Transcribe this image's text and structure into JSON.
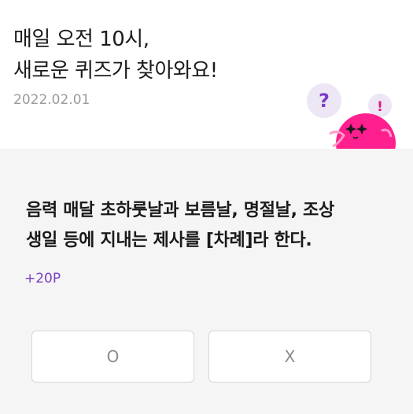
{
  "header": {
    "title_line1": "매일 오전 10시,",
    "title_line2": "새로운 퀴즈가 찾아와요!",
    "date": "2022.02.01"
  },
  "mascot": {
    "bubble_text": "?",
    "exclaim_text": "!",
    "body_color": "#ff1f8e",
    "bubble_color": "#ece6f5",
    "accent_color": "#7b3fc4"
  },
  "quiz": {
    "question_line1": "음력 매달 초하룻날과 보름날, 명절날, 조상",
    "question_line2": "생일 등에 지내는 제사를 [차례]라 한다.",
    "points": "+20P",
    "answer_o": "O",
    "answer_x": "X"
  },
  "colors": {
    "background": "#f5f5f5",
    "points": "#7b3fc4",
    "title_text": "#1b1b1b",
    "date_text": "#9a9a9a"
  }
}
